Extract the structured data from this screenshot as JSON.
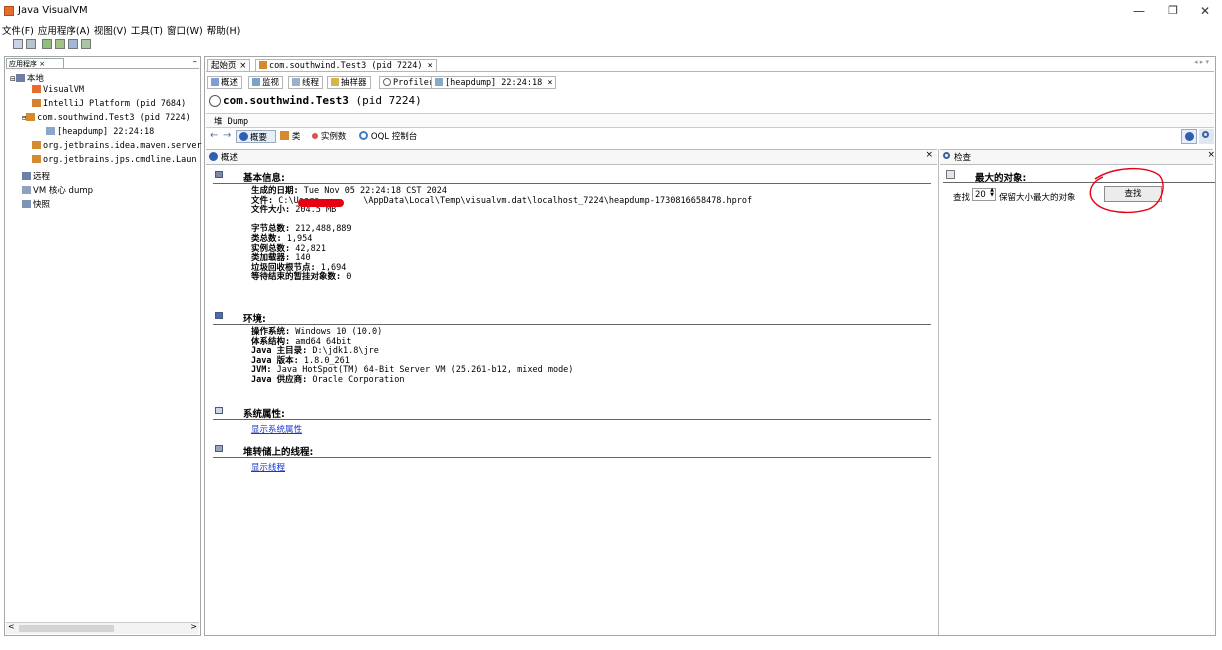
{
  "window": {
    "title": "Java VisualVM",
    "min": "—",
    "max": "❐",
    "close": "✕"
  },
  "menu": [
    "文件(F)",
    "应用程序(A)",
    "视图(V)",
    "工具(T)",
    "窗口(W)",
    "帮助(H)"
  ],
  "left_panel": {
    "tab": "应用程序 ×",
    "minimize": "–",
    "tree": [
      {
        "label": "本地",
        "icon": "local-icon"
      },
      {
        "label": "VisualVM",
        "icon": "visualvm-icon"
      },
      {
        "label": "IntelliJ Platform (pid 7684)",
        "icon": "intellij-icon"
      },
      {
        "label": "com.southwind.Test3 (pid 7224)",
        "icon": "java-icon"
      },
      {
        "label": "[heapdump] 22:24:18",
        "icon": "heapdump-icon"
      },
      {
        "label": "org.jetbrains.idea.maven.server",
        "icon": "java-icon"
      },
      {
        "label": "org.jetbrains.jps.cmdline.Laun",
        "icon": "java-icon"
      },
      {
        "label": "远程",
        "icon": "remote-icon"
      },
      {
        "label": "VM 核心 dump",
        "icon": "core-dump-icon"
      },
      {
        "label": "快照",
        "icon": "snapshot-icon"
      }
    ],
    "scroll_left": "<",
    "scroll_right": ">"
  },
  "doc_tabs": [
    {
      "label": "起始页 ×"
    },
    {
      "label": "com.southwind.Test3 (pid 7224) ×"
    }
  ],
  "nav_arrows": "◂ ▸ ▾",
  "sub_tabs": [
    "概述",
    "监视",
    "线程",
    "抽样器",
    "Profiler",
    "[heapdump] 22:24:18 ×"
  ],
  "process_title": "com.southwind.Test3",
  "process_pid": "(pid 7224)",
  "heap_dump_label": "堆 Dump",
  "view_toolbar": {
    "back": "←",
    "forward": "→",
    "summary": "概要",
    "classes": "类",
    "instances": "实例数",
    "oql": "OQL 控制台"
  },
  "overview_header": "概述",
  "overview_close": "×",
  "basic": {
    "title": "基本信息:",
    "date_label": "生成的日期:",
    "date": "Tue Nov 05 22:24:18 CST 2024",
    "file_label": "文件:",
    "file_start": "C:\\Users",
    "file_end": "\\AppData\\Local\\Temp\\visualvm.dat\\localhost_7224\\heapdump-1730816658478.hprof",
    "size_label": "文件大小:",
    "size": "204.5 MB",
    "bytes_label": "字节总数:",
    "bytes": "212,488,889",
    "classes_label": "类总数:",
    "classes": "1,954",
    "instances_label": "实例总数:",
    "instances": "42,821",
    "loaders_label": "类加载器:",
    "loaders": "140",
    "gcroots_label": "垃圾回收根节点:",
    "gcroots": "1,694",
    "pending_label": "等待结束的暂挂对象数:",
    "pending": "0"
  },
  "env": {
    "title": "环境:",
    "os_label": "操作系统:",
    "os": "Windows 10 (10.0)",
    "arch_label": "体系结构:",
    "arch": "amd64 64bit",
    "home_label": "Java 主目录:",
    "home": "D:\\jdk1.8\\jre",
    "version_label": "Java 版本:",
    "version": "1.8.0_261",
    "jvm_label": "JVM:",
    "jvm": "Java HotSpot(TM) 64-Bit Server VM (25.261-b12, mixed mode)",
    "vendor_label": "Java 供应商:",
    "vendor": "Oracle Corporation"
  },
  "sysprops": {
    "title": "系统属性:",
    "link": "显示系统属性"
  },
  "threads": {
    "title": "堆转储上的线程:",
    "link": "显示线程"
  },
  "inspect": {
    "header": "检查",
    "close": "×",
    "title": "最大的对象:",
    "find_label": "查找",
    "count": "20",
    "suffix": "保留大小最大的对象",
    "button": "查找"
  }
}
